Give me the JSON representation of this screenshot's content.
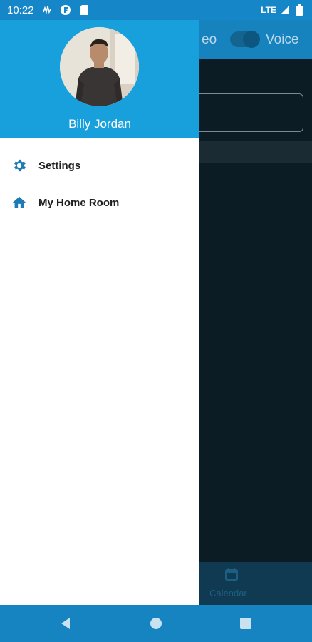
{
  "status_bar": {
    "time": "10:22",
    "network": "LTE",
    "icons": [
      "signal-wave-icon",
      "f-app-icon",
      "sd-card-icon",
      "cell-signal-icon",
      "battery-icon"
    ]
  },
  "background_app": {
    "mode_left_label": "eo",
    "mode_right_label": "Voice",
    "bottom_tab_label": "Calendar"
  },
  "drawer": {
    "user_name": "Billy Jordan",
    "items": [
      {
        "label": "Settings",
        "icon": "gear-icon"
      },
      {
        "label": "My Home Room",
        "icon": "home-icon"
      }
    ]
  },
  "nav_bar": {
    "buttons": [
      "back-icon",
      "home-circle-icon",
      "recents-icon"
    ]
  },
  "colors": {
    "status_bar": "#1587c8",
    "drawer_header": "#18a0dd",
    "icon_accent": "#1e7ab4",
    "background": "#0b1c25"
  }
}
